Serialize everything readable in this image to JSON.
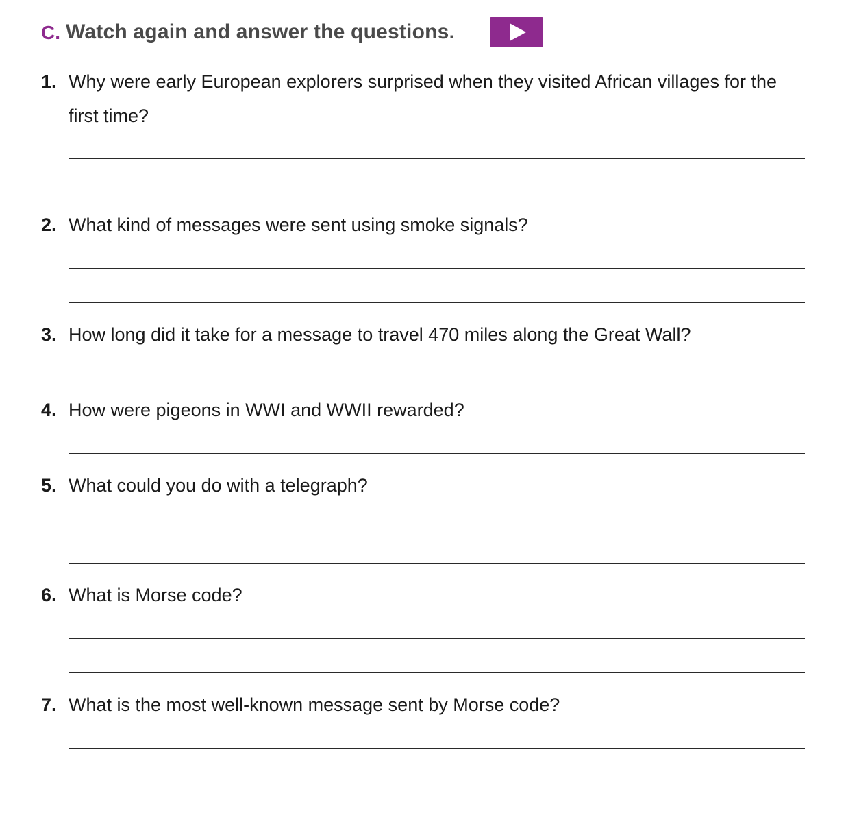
{
  "header": {
    "section_letter": "C.",
    "title": "Watch again and answer the questions.",
    "play_button_color": "#8e2a8e",
    "play_icon": "play-icon"
  },
  "questions": [
    {
      "number": "1.",
      "text": "Why were early European explorers surprised when they visited African villages for the first time?"
    },
    {
      "number": "2.",
      "text": "What kind of messages were sent using smoke signals?"
    },
    {
      "number": "3.",
      "text": "How long did it take for a message to travel 470 miles along the Great Wall?"
    },
    {
      "number": "4.",
      "text": "How were pigeons in WWI and WWII rewarded?"
    },
    {
      "number": "5.",
      "text": "What could you do with a telegraph?"
    },
    {
      "number": "6.",
      "text": "What is Morse code?"
    },
    {
      "number": "7.",
      "text": "What is the most well-known message sent by Morse code?"
    }
  ]
}
